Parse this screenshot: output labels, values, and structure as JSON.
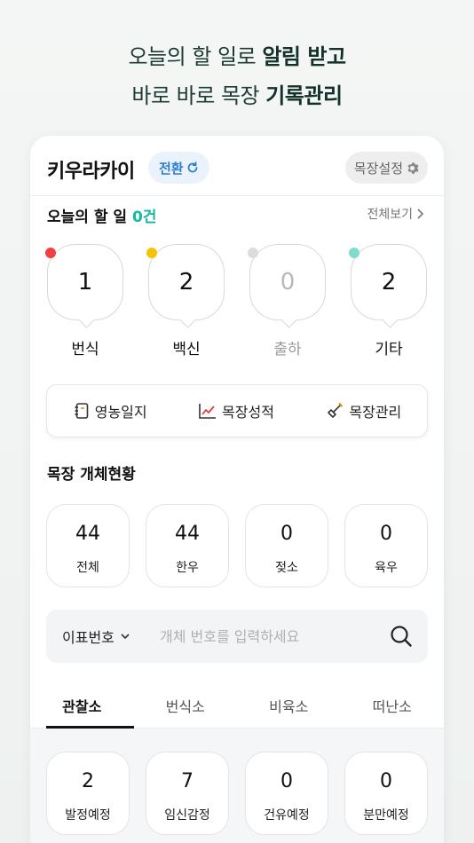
{
  "promo": {
    "line1_normal": "오늘의 할 일로 ",
    "line1_bold": "알림 받고",
    "line2_normal": "바로 바로 목장 ",
    "line2_bold": "기록관리"
  },
  "header": {
    "farm_name": "키우라카이",
    "switch_label": "전환",
    "settings_label": "목장설정"
  },
  "today": {
    "title": "오늘의 할 일",
    "count": "0건",
    "view_all": "전체보기"
  },
  "tasks": [
    {
      "value": "1",
      "label": "번식",
      "dot_color": "#f0403f"
    },
    {
      "value": "2",
      "label": "백신",
      "dot_color": "#f5c400"
    },
    {
      "value": "0",
      "label": "출하",
      "dot_color": "#dcdcdc"
    },
    {
      "value": "2",
      "label": "기타",
      "dot_color": "#7fdccd"
    }
  ],
  "tools": [
    {
      "label": "영농일지",
      "icon": "notebook-icon"
    },
    {
      "label": "목장성적",
      "icon": "line-chart-icon"
    },
    {
      "label": "목장관리",
      "icon": "shovel-icon"
    }
  ],
  "stats": {
    "title": "목장 개체현황",
    "items": [
      {
        "value": "44",
        "label": "전체"
      },
      {
        "value": "44",
        "label": "한우"
      },
      {
        "value": "0",
        "label": "젖소"
      },
      {
        "value": "0",
        "label": "육우"
      }
    ]
  },
  "search": {
    "type_label": "이표번호",
    "placeholder": "개체 번호를 입력하세요"
  },
  "tabs": [
    {
      "label": "관찰소",
      "active": true
    },
    {
      "label": "번식소",
      "active": false
    },
    {
      "label": "비육소",
      "active": false
    },
    {
      "label": "떠난소",
      "active": false
    }
  ],
  "observation": [
    {
      "value": "2",
      "label": "발정예정"
    },
    {
      "value": "7",
      "label": "임신감정"
    },
    {
      "value": "0",
      "label": "건유예정"
    },
    {
      "value": "0",
      "label": "분만예정"
    }
  ],
  "colors": {
    "accent": "#13b7a4",
    "switch_text": "#2f7fd0"
  }
}
